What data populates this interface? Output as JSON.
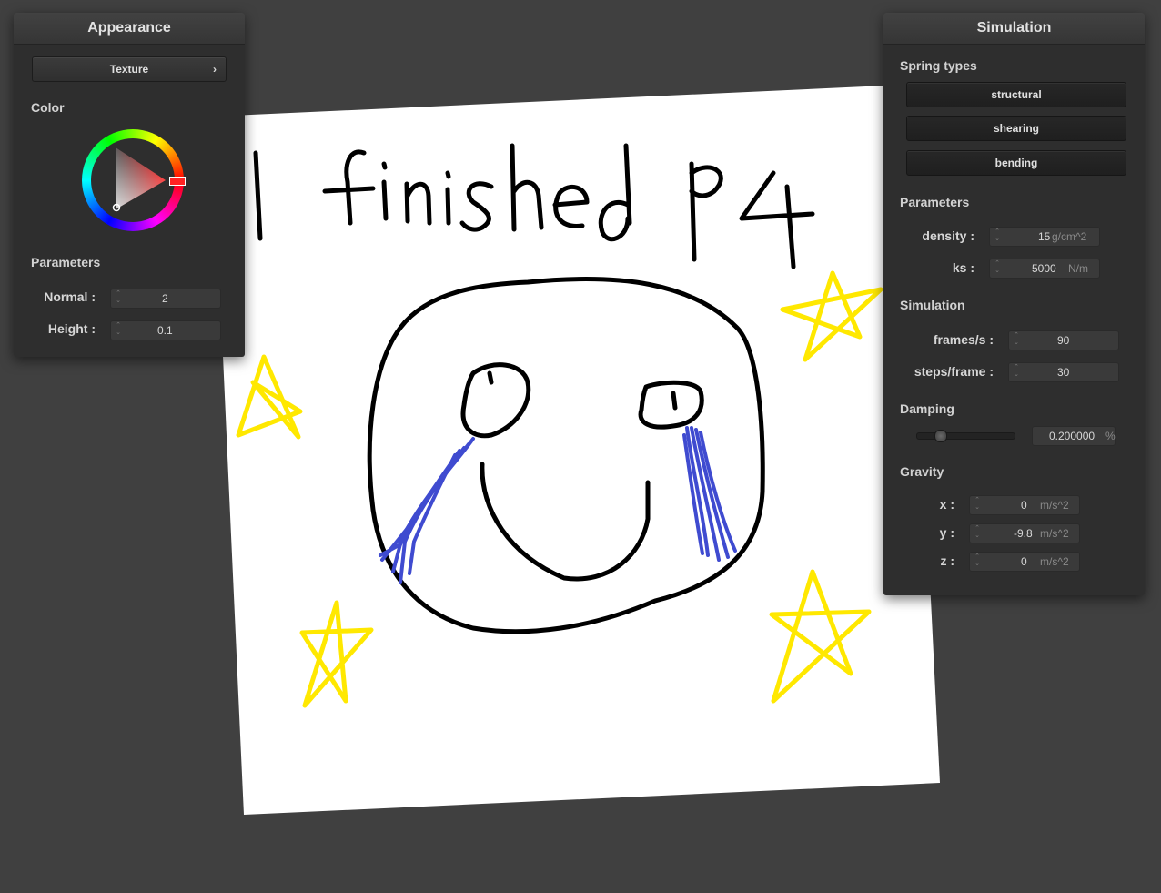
{
  "canvas": {
    "handwriting": "I finished P4"
  },
  "appearance": {
    "title": "Appearance",
    "texture_button": "Texture",
    "texture_chevron": "›",
    "color_label": "Color",
    "parameters_label": "Parameters",
    "normal_label": "Normal :",
    "normal_value": "2",
    "height_label": "Height :",
    "height_value": "0.1",
    "selected_color": "#ff0000"
  },
  "simulation": {
    "title": "Simulation",
    "spring_types_label": "Spring types",
    "spring_buttons": [
      "structural",
      "shearing",
      "bending"
    ],
    "parameters_label": "Parameters",
    "density_label": "density :",
    "density_value": "15",
    "density_unit": "g/cm^2",
    "ks_label": "ks :",
    "ks_value": "5000",
    "ks_unit": "N/m",
    "simulation_label": "Simulation",
    "fps_label": "frames/s :",
    "fps_value": "90",
    "steps_label": "steps/frame :",
    "steps_value": "30",
    "damping_label": "Damping",
    "damping_value": "0.200000",
    "damping_unit": "%",
    "damping_slider_fraction": 0.2,
    "gravity_label": "Gravity",
    "gx_label": "x :",
    "gx_value": "0",
    "gy_label": "y :",
    "gy_value": "-9.8",
    "gz_label": "z :",
    "gz_value": "0",
    "gravity_unit": "m/s^2"
  },
  "colors": {
    "background": "#404040",
    "panel": "#2e2e2e",
    "tear_blue": "#3f4bd0",
    "star_yellow": "#ffe800",
    "ink": "#000000"
  }
}
